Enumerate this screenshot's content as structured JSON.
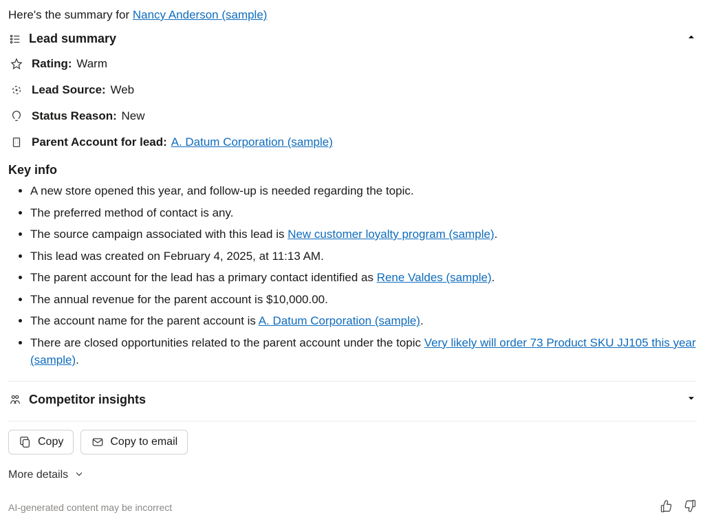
{
  "intro": {
    "prefix": "Here's the summary for ",
    "link": "Nancy Anderson (sample)"
  },
  "lead_summary": {
    "title": "Lead summary",
    "rating_label": "Rating",
    "rating_value": "Warm",
    "lead_source_label": "Lead Source",
    "lead_source_value": "Web",
    "status_reason_label": "Status Reason",
    "status_reason_value": "New",
    "parent_account_label": "Parent Account for lead",
    "parent_account_link": "A. Datum Corporation (sample)"
  },
  "key_info": {
    "title": "Key info",
    "item0": "A new store opened this year, and follow-up is needed regarding the topic.",
    "item1": "The preferred method of contact is any.",
    "item2_prefix": "The source campaign associated with this lead is ",
    "item2_link": "New customer loyalty program (sample)",
    "item2_suffix": ".",
    "item3": "This lead was created on February 4, 2025, at 11:13 AM.",
    "item4_prefix": "The parent account for the lead has a primary contact identified as ",
    "item4_link": "Rene Valdes (sample)",
    "item4_suffix": ".",
    "item5": "The annual revenue for the parent account is $10,000.00.",
    "item6_prefix": "The account name for the parent account is ",
    "item6_link": "A. Datum Corporation (sample)",
    "item6_suffix": ".",
    "item7_prefix": "There are closed opportunities related to the parent account under the topic ",
    "item7_link": "Very likely will order 73 Product SKU JJ105 this year (sample)",
    "item7_suffix": "."
  },
  "competitor": {
    "title": "Competitor insights"
  },
  "actions": {
    "copy": "Copy",
    "copy_email": "Copy to email"
  },
  "more_details": "More details",
  "disclaimer": "AI-generated content may be incorrect"
}
